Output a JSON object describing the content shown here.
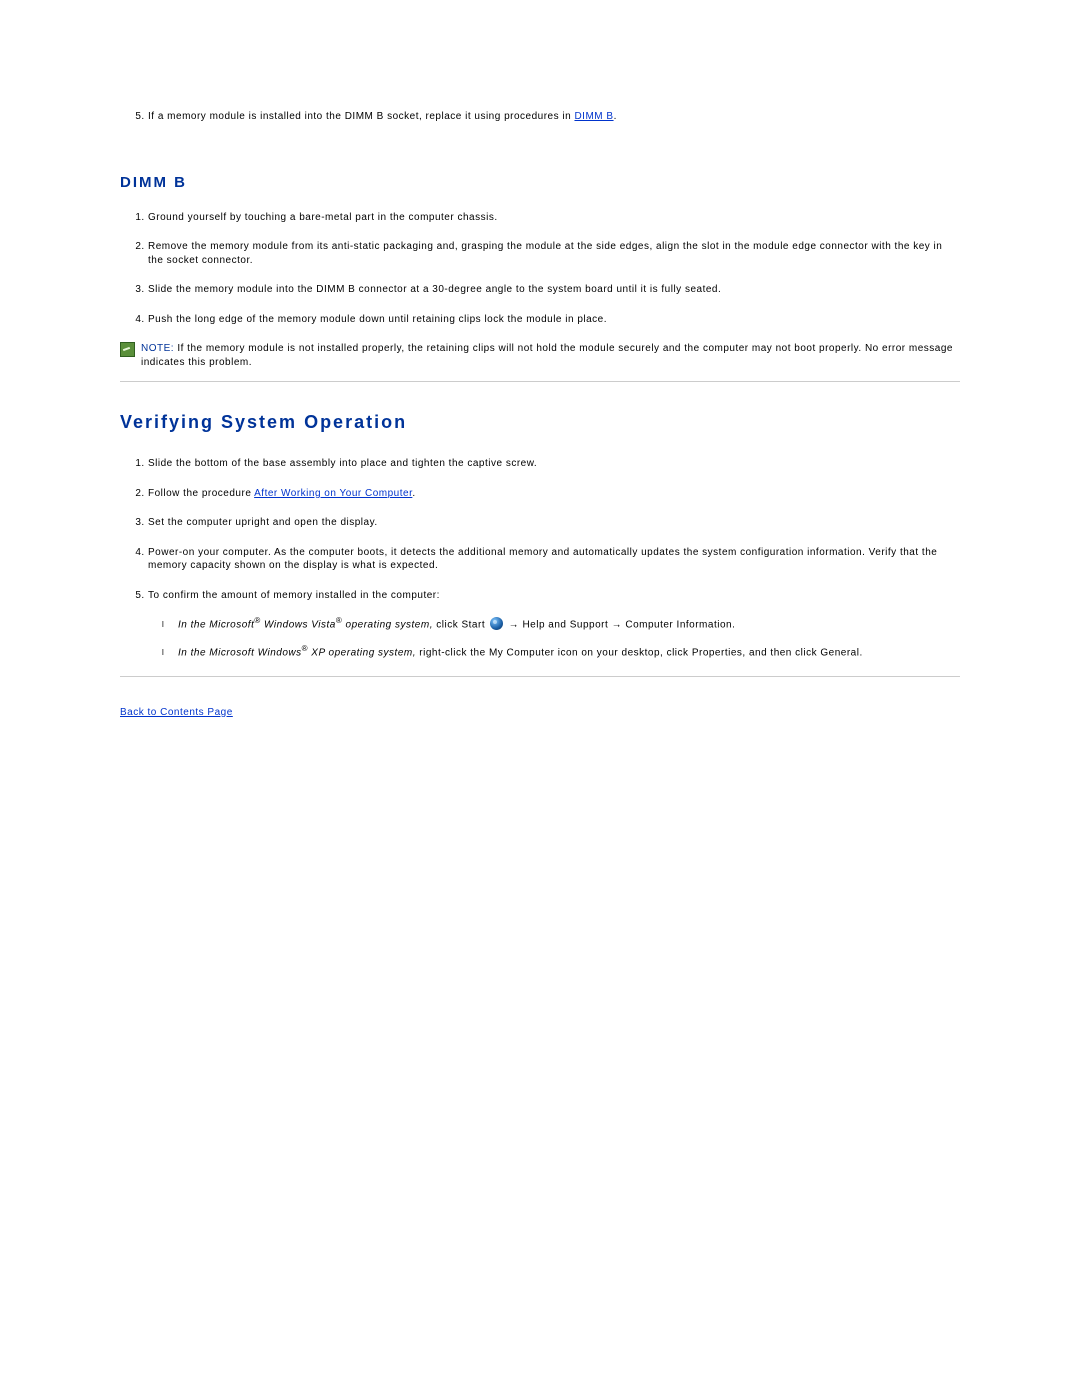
{
  "topList": {
    "item5_prefix": "If a memory module is installed into the DIMM B socket, replace it using procedures in ",
    "item5_link": "DIMM B",
    "item5_suffix": "."
  },
  "dimmb": {
    "title": "DIMM B",
    "items": [
      "Ground yourself by touching a bare-metal part in the computer chassis.",
      "Remove the memory module from its anti-static packaging and, grasping the module at the side edges, align the slot in the module edge connector with the key in the socket connector.",
      "Slide the memory module into the DIMM B connector at a 30-degree angle to the system board until it is fully seated.",
      "Push the long edge of the memory module down until retaining clips lock the module in place."
    ]
  },
  "note": {
    "label": "NOTE:",
    "text": " If the memory module is not installed properly, the retaining clips will not hold the module securely and the computer may not boot properly. No error message indicates this problem."
  },
  "verify": {
    "title": "Verifying System Operation",
    "items": {
      "i1": "Slide the bottom of the base assembly into place and tighten the captive screw.",
      "i2_prefix": "Follow the procedure ",
      "i2_link": "After Working on Your Computer",
      "i2_suffix": ".",
      "i3": "Set the computer upright and open the display.",
      "i4": "Power-on your computer. As the computer boots, it detects the additional memory and automatically updates the system configuration information. Verify that the memory capacity shown on the display is what is expected.",
      "i5": "To confirm the amount of memory installed in the computer:"
    },
    "vista": {
      "italic1": "In the Microsoft",
      "reg1": "®",
      "italic2": " Windows Vista",
      "reg2": "®",
      "italic3": " operating system,",
      "plain1": " click ",
      "start": "Start",
      "arrow1": " → ",
      "help": "Help and Support",
      "arrow2": " → ",
      "info": "Computer Information",
      "dot": "."
    },
    "xp": {
      "italic1": "In the Microsoft Windows",
      "reg1": "®",
      "italic2": " XP operating system,",
      "plain1": " right-click the ",
      "mycomp": "My Computer",
      "plain2": " icon on your desktop, click ",
      "props": "Properties",
      "plain3": ", and then click ",
      "general": "General",
      "dot": "."
    }
  },
  "back": {
    "label": "Back to Contents Page"
  }
}
